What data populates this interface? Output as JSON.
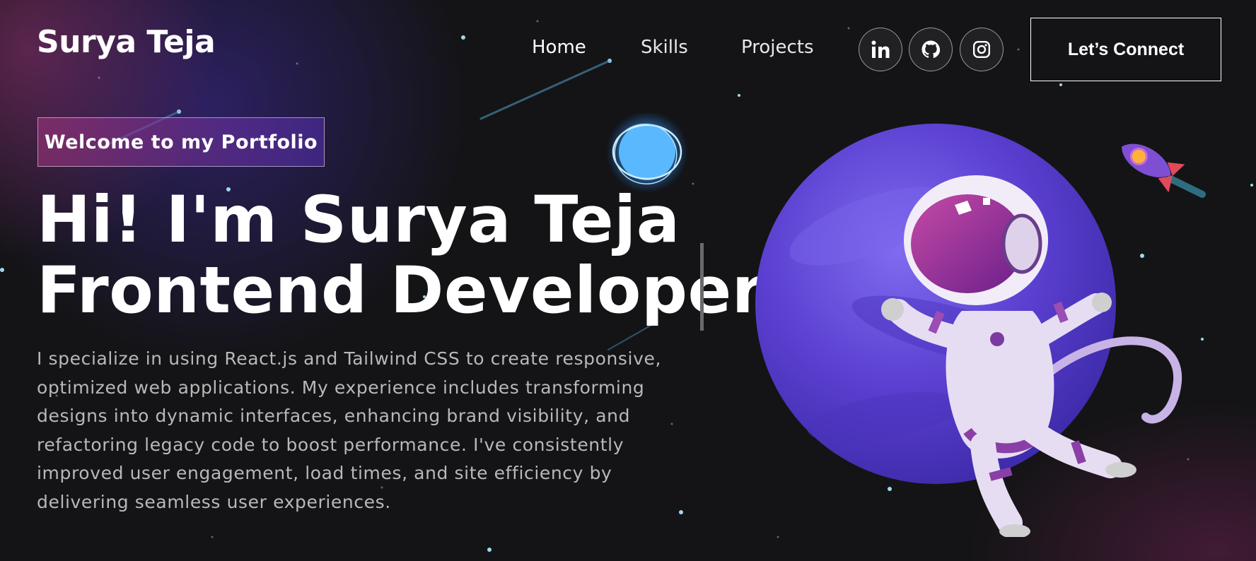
{
  "nav": {
    "brand": "Surya Teja",
    "links": [
      {
        "label": "Home",
        "active": true
      },
      {
        "label": "Skills",
        "active": false
      },
      {
        "label": "Projects",
        "active": false
      }
    ],
    "social_icons": [
      "linkedin-icon",
      "github-icon",
      "instagram-icon"
    ],
    "cta_label": "Let’s Connect"
  },
  "hero": {
    "tagline": "Welcome to my Portfolio",
    "greeting": "Hi! I'm Surya Teja",
    "rotating_title": "Frontend Developer",
    "description": "I specialize in using React.js and Tailwind CSS to create responsive, optimized web applications. My experience includes transforming designs into dynamic interfaces, enhancing brand visibility, and refactoring legacy code to boost performance. I've consistently improved user engagement, load times, and site efficiency by delivering seamless user experiences."
  },
  "colors": {
    "background": "#121212",
    "gradient_pink": "#AA367C",
    "gradient_purple": "#4A2FBD",
    "text_primary": "#FFFFFF",
    "text_secondary": "#B8B8B8"
  }
}
